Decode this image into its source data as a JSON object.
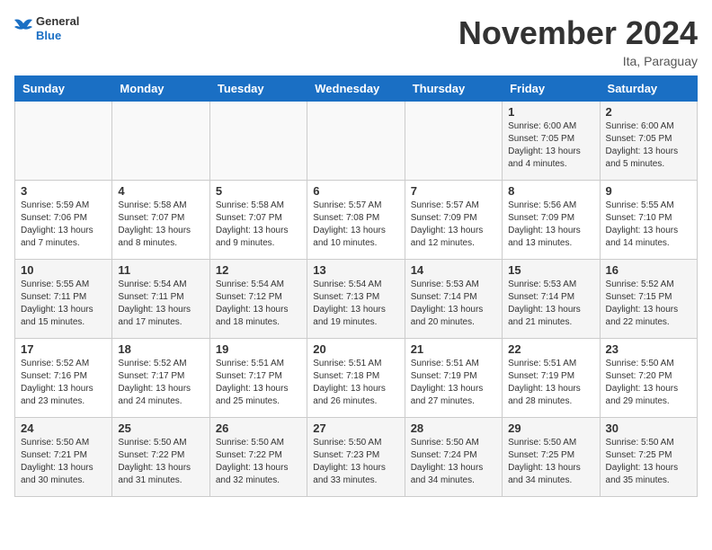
{
  "header": {
    "logo_line1": "General",
    "logo_line2": "Blue",
    "month_title": "November 2024",
    "location": "Ita, Paraguay"
  },
  "weekdays": [
    "Sunday",
    "Monday",
    "Tuesday",
    "Wednesday",
    "Thursday",
    "Friday",
    "Saturday"
  ],
  "weeks": [
    [
      {
        "day": "",
        "sunrise": "",
        "sunset": "",
        "daylight": ""
      },
      {
        "day": "",
        "sunrise": "",
        "sunset": "",
        "daylight": ""
      },
      {
        "day": "",
        "sunrise": "",
        "sunset": "",
        "daylight": ""
      },
      {
        "day": "",
        "sunrise": "",
        "sunset": "",
        "daylight": ""
      },
      {
        "day": "",
        "sunrise": "",
        "sunset": "",
        "daylight": ""
      },
      {
        "day": "1",
        "sunrise": "Sunrise: 6:00 AM",
        "sunset": "Sunset: 7:05 PM",
        "daylight": "Daylight: 13 hours and 4 minutes."
      },
      {
        "day": "2",
        "sunrise": "Sunrise: 6:00 AM",
        "sunset": "Sunset: 7:05 PM",
        "daylight": "Daylight: 13 hours and 5 minutes."
      }
    ],
    [
      {
        "day": "3",
        "sunrise": "Sunrise: 5:59 AM",
        "sunset": "Sunset: 7:06 PM",
        "daylight": "Daylight: 13 hours and 7 minutes."
      },
      {
        "day": "4",
        "sunrise": "Sunrise: 5:58 AM",
        "sunset": "Sunset: 7:07 PM",
        "daylight": "Daylight: 13 hours and 8 minutes."
      },
      {
        "day": "5",
        "sunrise": "Sunrise: 5:58 AM",
        "sunset": "Sunset: 7:07 PM",
        "daylight": "Daylight: 13 hours and 9 minutes."
      },
      {
        "day": "6",
        "sunrise": "Sunrise: 5:57 AM",
        "sunset": "Sunset: 7:08 PM",
        "daylight": "Daylight: 13 hours and 10 minutes."
      },
      {
        "day": "7",
        "sunrise": "Sunrise: 5:57 AM",
        "sunset": "Sunset: 7:09 PM",
        "daylight": "Daylight: 13 hours and 12 minutes."
      },
      {
        "day": "8",
        "sunrise": "Sunrise: 5:56 AM",
        "sunset": "Sunset: 7:09 PM",
        "daylight": "Daylight: 13 hours and 13 minutes."
      },
      {
        "day": "9",
        "sunrise": "Sunrise: 5:55 AM",
        "sunset": "Sunset: 7:10 PM",
        "daylight": "Daylight: 13 hours and 14 minutes."
      }
    ],
    [
      {
        "day": "10",
        "sunrise": "Sunrise: 5:55 AM",
        "sunset": "Sunset: 7:11 PM",
        "daylight": "Daylight: 13 hours and 15 minutes."
      },
      {
        "day": "11",
        "sunrise": "Sunrise: 5:54 AM",
        "sunset": "Sunset: 7:11 PM",
        "daylight": "Daylight: 13 hours and 17 minutes."
      },
      {
        "day": "12",
        "sunrise": "Sunrise: 5:54 AM",
        "sunset": "Sunset: 7:12 PM",
        "daylight": "Daylight: 13 hours and 18 minutes."
      },
      {
        "day": "13",
        "sunrise": "Sunrise: 5:54 AM",
        "sunset": "Sunset: 7:13 PM",
        "daylight": "Daylight: 13 hours and 19 minutes."
      },
      {
        "day": "14",
        "sunrise": "Sunrise: 5:53 AM",
        "sunset": "Sunset: 7:14 PM",
        "daylight": "Daylight: 13 hours and 20 minutes."
      },
      {
        "day": "15",
        "sunrise": "Sunrise: 5:53 AM",
        "sunset": "Sunset: 7:14 PM",
        "daylight": "Daylight: 13 hours and 21 minutes."
      },
      {
        "day": "16",
        "sunrise": "Sunrise: 5:52 AM",
        "sunset": "Sunset: 7:15 PM",
        "daylight": "Daylight: 13 hours and 22 minutes."
      }
    ],
    [
      {
        "day": "17",
        "sunrise": "Sunrise: 5:52 AM",
        "sunset": "Sunset: 7:16 PM",
        "daylight": "Daylight: 13 hours and 23 minutes."
      },
      {
        "day": "18",
        "sunrise": "Sunrise: 5:52 AM",
        "sunset": "Sunset: 7:17 PM",
        "daylight": "Daylight: 13 hours and 24 minutes."
      },
      {
        "day": "19",
        "sunrise": "Sunrise: 5:51 AM",
        "sunset": "Sunset: 7:17 PM",
        "daylight": "Daylight: 13 hours and 25 minutes."
      },
      {
        "day": "20",
        "sunrise": "Sunrise: 5:51 AM",
        "sunset": "Sunset: 7:18 PM",
        "daylight": "Daylight: 13 hours and 26 minutes."
      },
      {
        "day": "21",
        "sunrise": "Sunrise: 5:51 AM",
        "sunset": "Sunset: 7:19 PM",
        "daylight": "Daylight: 13 hours and 27 minutes."
      },
      {
        "day": "22",
        "sunrise": "Sunrise: 5:51 AM",
        "sunset": "Sunset: 7:19 PM",
        "daylight": "Daylight: 13 hours and 28 minutes."
      },
      {
        "day": "23",
        "sunrise": "Sunrise: 5:50 AM",
        "sunset": "Sunset: 7:20 PM",
        "daylight": "Daylight: 13 hours and 29 minutes."
      }
    ],
    [
      {
        "day": "24",
        "sunrise": "Sunrise: 5:50 AM",
        "sunset": "Sunset: 7:21 PM",
        "daylight": "Daylight: 13 hours and 30 minutes."
      },
      {
        "day": "25",
        "sunrise": "Sunrise: 5:50 AM",
        "sunset": "Sunset: 7:22 PM",
        "daylight": "Daylight: 13 hours and 31 minutes."
      },
      {
        "day": "26",
        "sunrise": "Sunrise: 5:50 AM",
        "sunset": "Sunset: 7:22 PM",
        "daylight": "Daylight: 13 hours and 32 minutes."
      },
      {
        "day": "27",
        "sunrise": "Sunrise: 5:50 AM",
        "sunset": "Sunset: 7:23 PM",
        "daylight": "Daylight: 13 hours and 33 minutes."
      },
      {
        "day": "28",
        "sunrise": "Sunrise: 5:50 AM",
        "sunset": "Sunset: 7:24 PM",
        "daylight": "Daylight: 13 hours and 34 minutes."
      },
      {
        "day": "29",
        "sunrise": "Sunrise: 5:50 AM",
        "sunset": "Sunset: 7:25 PM",
        "daylight": "Daylight: 13 hours and 34 minutes."
      },
      {
        "day": "30",
        "sunrise": "Sunrise: 5:50 AM",
        "sunset": "Sunset: 7:25 PM",
        "daylight": "Daylight: 13 hours and 35 minutes."
      }
    ]
  ]
}
